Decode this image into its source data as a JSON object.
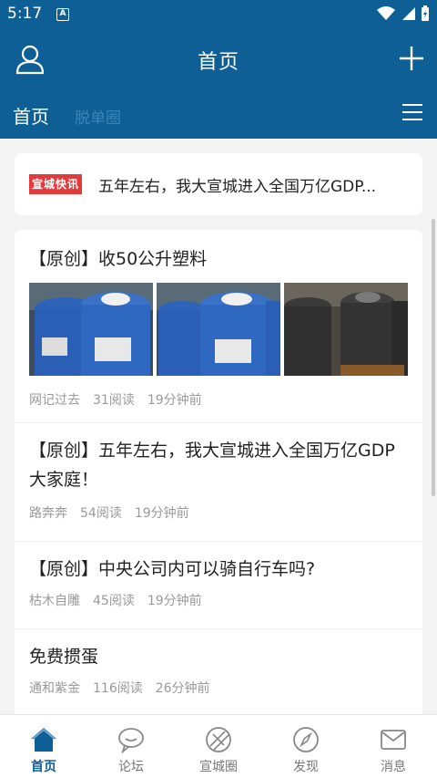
{
  "status_bar": {
    "time": "5:17",
    "notification_icon": "A"
  },
  "header": {
    "title": "首页",
    "tabs": [
      {
        "label": "首页",
        "active": true
      },
      {
        "label": "脱单圈",
        "active": false
      }
    ],
    "accent_color": "#0d5f96"
  },
  "news_flash": {
    "logo_text": "宣城快讯",
    "headline": "五年左右，我大宣城进入全国万亿GDP..."
  },
  "feed": [
    {
      "title": "【原创】收50公升塑料",
      "author": "网记过去",
      "reads": "31阅读",
      "time": "19分钟前",
      "images": [
        "blue-plastic-barrel",
        "blue-plastic-barrel",
        "black-plastic-barrels"
      ]
    },
    {
      "title": "【原创】五年左右，我大宣城进入全国万亿GDP大家庭！",
      "author": "路奔奔",
      "reads": "54阅读",
      "time": "19分钟前"
    },
    {
      "title": "【原创】中央公司内可以骑自行车吗?",
      "author": "枯木自雕",
      "reads": "45阅读",
      "time": "19分钟前"
    },
    {
      "title": "免费掼蛋",
      "author": "通和紫金",
      "reads": "116阅读",
      "time": "26分钟前"
    }
  ],
  "bottom_nav": [
    {
      "label": "首页",
      "icon": "home-icon",
      "active": true
    },
    {
      "label": "论坛",
      "icon": "chat-icon",
      "active": false
    },
    {
      "label": "宣城圈",
      "icon": "circle-icon",
      "active": false
    },
    {
      "label": "发现",
      "icon": "compass-icon",
      "active": false
    },
    {
      "label": "消息",
      "icon": "mail-icon",
      "active": false
    }
  ]
}
